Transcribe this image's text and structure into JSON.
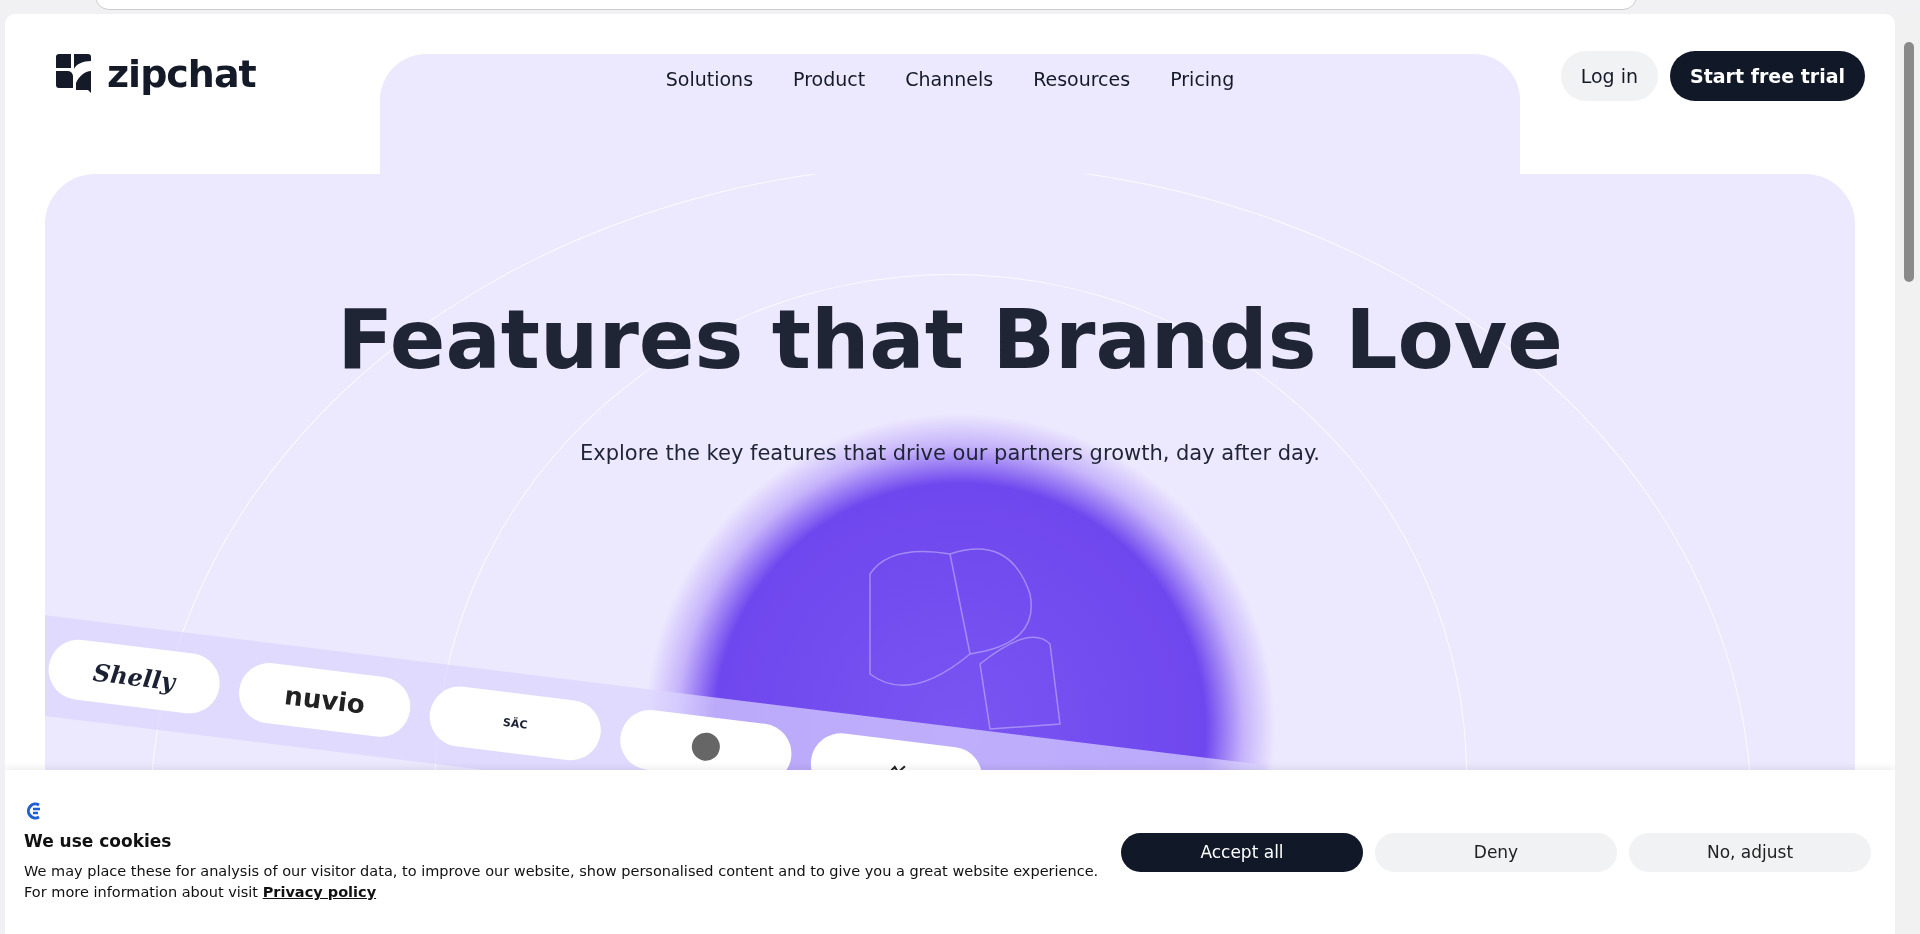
{
  "brand": {
    "name": "zipchat"
  },
  "nav": {
    "items": [
      {
        "label": "Solutions"
      },
      {
        "label": "Product"
      },
      {
        "label": "Channels"
      },
      {
        "label": "Resources"
      },
      {
        "label": "Pricing"
      }
    ]
  },
  "actions": {
    "login": "Log in",
    "trial": "Start free trial"
  },
  "hero": {
    "title": "Features that Brands Love",
    "subtitle": "Explore the key features that drive our partners growth, day after day."
  },
  "partner_logos": [
    {
      "kind": "text",
      "label": "Shelly"
    },
    {
      "kind": "text",
      "label": "nuvio"
    },
    {
      "kind": "text",
      "label": "SÄC"
    },
    {
      "kind": "emblem"
    },
    {
      "kind": "mark"
    }
  ],
  "cookie_banner": {
    "title": "We use cookies",
    "text": "We may place these for analysis of our visitor data, to improve our website, show personalised content and to give you a great website experience. For more information about visit",
    "link": "Privacy policy",
    "buttons": [
      {
        "label": "Accept all",
        "primary": true
      },
      {
        "label": "Deny",
        "primary": false
      },
      {
        "label": "No, adjust",
        "primary": false
      }
    ]
  }
}
